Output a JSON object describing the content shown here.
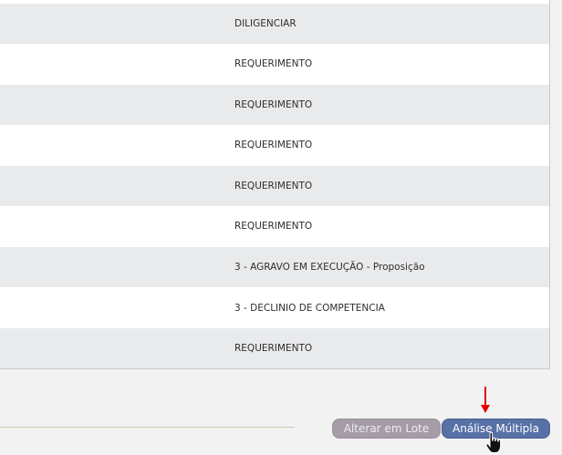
{
  "table": {
    "rows": [
      {
        "text": "DILIGENCIAR"
      },
      {
        "text": "REQUERIMENTO"
      },
      {
        "text": "REQUERIMENTO"
      },
      {
        "text": "REQUERIMENTO"
      },
      {
        "text": "REQUERIMENTO"
      },
      {
        "text": "REQUERIMENTO"
      },
      {
        "text": "3 - AGRAVO EM EXECUÇÃO - Proposição"
      },
      {
        "text": "3 - DECLINIO DE COMPETENCIA"
      },
      {
        "text": "REQUERIMENTO"
      }
    ]
  },
  "actions": {
    "alterar_lote_label": "Alterar em Lote",
    "analise_multipla_label": "Análise Múltipla"
  },
  "colors": {
    "row_shaded": "#e9eaec",
    "alterar_lote_bg": "#a59ca7",
    "analise_multipla_bg": "#5770a6",
    "indicator_arrow": "#e30000"
  },
  "icons": {
    "indicator": "red-down-arrow-icon",
    "pointer": "hand-pointer-cursor-icon"
  }
}
